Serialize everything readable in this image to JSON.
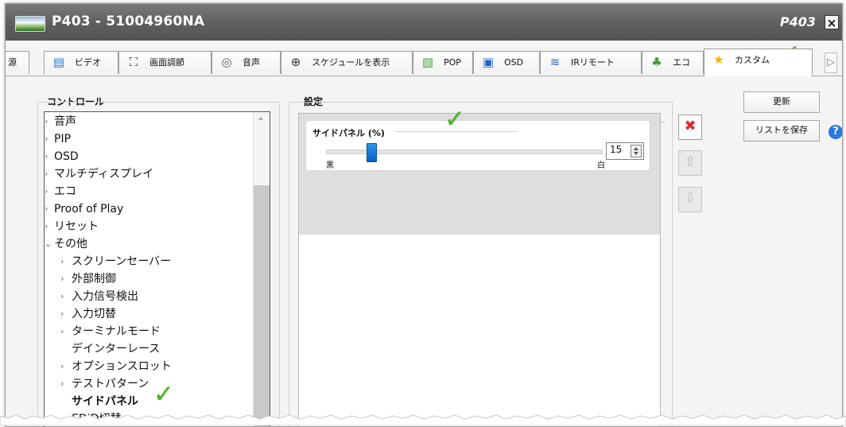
{
  "titlebar": {
    "title": "P403 - 51004960NA",
    "short_title": "P403",
    "close_label": "×"
  },
  "tabs": [
    {
      "label": "源",
      "icon": "input-source-icon"
    },
    {
      "label": "ビデオ",
      "icon": "video-icon"
    },
    {
      "label": "画面調節",
      "icon": "picture-adjust-icon"
    },
    {
      "label": "音声",
      "icon": "speaker-icon"
    },
    {
      "label": "スケジュールを表示",
      "icon": "add-schedule-icon"
    },
    {
      "label": "POP",
      "icon": "pop-icon"
    },
    {
      "label": "OSD",
      "icon": "monitor-icon"
    },
    {
      "label": "IRリモート",
      "icon": "wireless-icon"
    },
    {
      "label": "エコ",
      "icon": "eco-leaf-icon"
    },
    {
      "label": "カスタム",
      "icon": "star-icon"
    }
  ],
  "control_panel": {
    "title": "コントロール",
    "items": [
      {
        "label": "音声",
        "level": 0,
        "expander": "›"
      },
      {
        "label": "PIP",
        "level": 0,
        "expander": "›"
      },
      {
        "label": "OSD",
        "level": 0,
        "expander": "›"
      },
      {
        "label": "マルチディスプレイ",
        "level": 0,
        "expander": "›"
      },
      {
        "label": "エコ",
        "level": 0,
        "expander": "›"
      },
      {
        "label": "Proof of Play",
        "level": 0,
        "expander": "›"
      },
      {
        "label": "リセット",
        "level": 0,
        "expander": "›"
      },
      {
        "label": "その他",
        "level": 0,
        "expander": "⌄"
      },
      {
        "label": "スクリーンセーバー",
        "level": 1,
        "expander": "›"
      },
      {
        "label": "外部制御",
        "level": 1,
        "expander": "›"
      },
      {
        "label": "入力信号検出",
        "level": 1,
        "expander": "›"
      },
      {
        "label": "入力切替",
        "level": 1,
        "expander": "›"
      },
      {
        "label": "ターミナルモード",
        "level": 1,
        "expander": "›"
      },
      {
        "label": "デインターレース",
        "level": 1,
        "expander": ""
      },
      {
        "label": "オプションスロット",
        "level": 1,
        "expander": "›"
      },
      {
        "label": "テストパターン",
        "level": 1,
        "expander": "›"
      },
      {
        "label": "サイドパネル",
        "level": 1,
        "expander": "",
        "selected": true
      },
      {
        "label": "EDID切替",
        "level": 1,
        "expander": ""
      }
    ]
  },
  "settings_panel": {
    "title": "設定",
    "setting_label": "サイドパネル (%)",
    "value": "15",
    "slider_level_fraction": 0.15,
    "min_label": "黒",
    "max_label": "白"
  },
  "actions": {
    "update_label": "更新",
    "save_list_label": "リストを保存",
    "help_label": "?"
  }
}
